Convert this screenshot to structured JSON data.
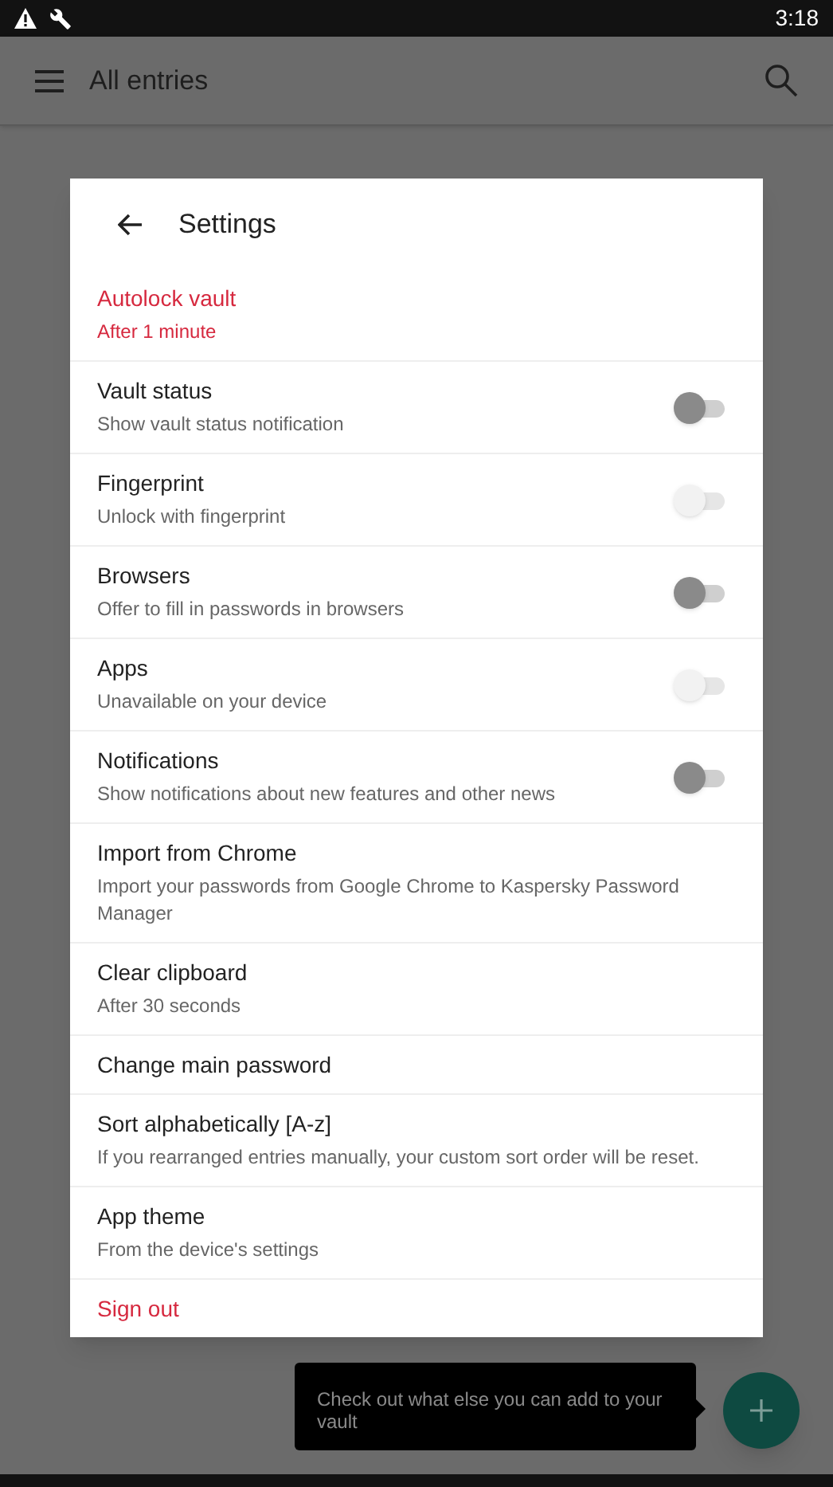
{
  "status_bar": {
    "time": "3:18"
  },
  "app_bar": {
    "title": "All entries"
  },
  "dialog": {
    "title": "Settings",
    "items": [
      {
        "kind": "accent",
        "title": "Autolock vault",
        "subtitle": "After 1 minute"
      },
      {
        "kind": "toggle",
        "title": "Vault status",
        "subtitle": "Show vault status notification",
        "on": false,
        "disabled": false
      },
      {
        "kind": "toggle",
        "title": "Fingerprint",
        "subtitle": "Unlock with fingerprint",
        "on": false,
        "disabled": true
      },
      {
        "kind": "toggle",
        "title": "Browsers",
        "subtitle": "Offer to fill in passwords in browsers",
        "on": false,
        "disabled": false
      },
      {
        "kind": "toggle",
        "title": "Apps",
        "subtitle": "Unavailable on your device",
        "on": false,
        "disabled": true
      },
      {
        "kind": "toggle",
        "title": "Notifications",
        "subtitle": "Show notifications about new features and other news",
        "on": false,
        "disabled": false
      },
      {
        "kind": "plain",
        "title": "Import from Chrome",
        "subtitle": "Import your passwords from Google Chrome to Kaspersky Password Manager"
      },
      {
        "kind": "plain",
        "title": "Clear clipboard",
        "subtitle": "After 30 seconds"
      },
      {
        "kind": "plain",
        "title": "Change main password"
      },
      {
        "kind": "plain",
        "title": "Sort alphabetically [A-z]",
        "subtitle": "If you rearranged entries manually, your custom sort order will be reset."
      },
      {
        "kind": "plain",
        "title": "App theme",
        "subtitle": "From the device's settings"
      },
      {
        "kind": "accent",
        "title": "Sign out"
      }
    ]
  },
  "tooltip": {
    "text": "Check out what else you can add to your vault"
  }
}
